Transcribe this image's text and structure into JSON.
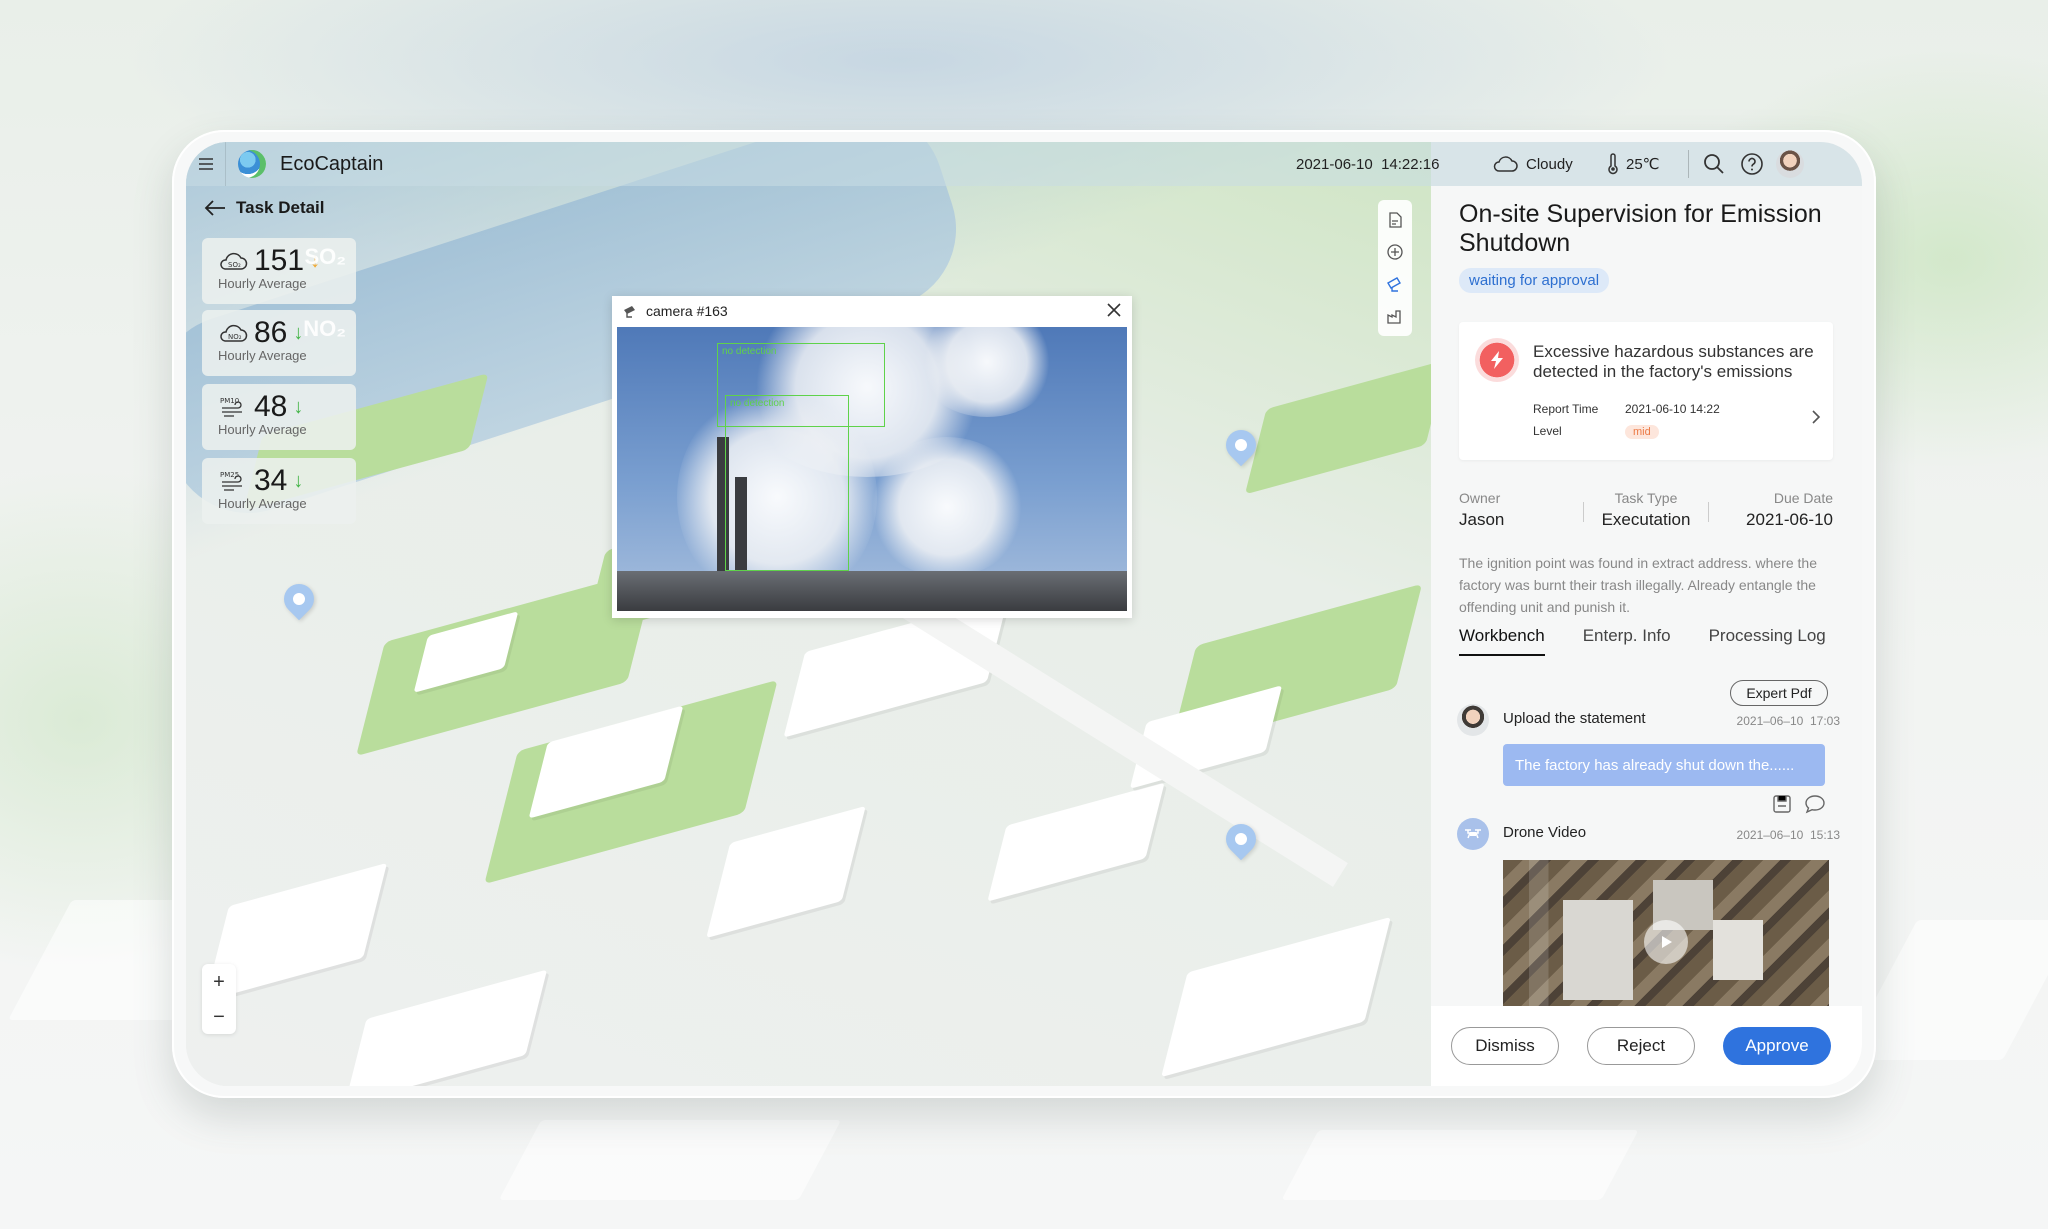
{
  "app": {
    "name": "EcoCaptain"
  },
  "topbar": {
    "date": "2021-06-10",
    "time": "14:22:16",
    "weather": "Cloudy",
    "temperature": "25℃"
  },
  "page": {
    "title": "Task Detail"
  },
  "metrics": [
    {
      "key": "SO₂",
      "value": "151",
      "trend": "up",
      "label": "Hourly Average",
      "arrow_color": "#f0a830"
    },
    {
      "key": "NO₂",
      "value": "86",
      "trend": "down",
      "label": "Hourly Average",
      "arrow_color": "#45b549"
    },
    {
      "key": "PM10",
      "value": "48",
      "trend": "down",
      "label": "Hourly Average",
      "arrow_color": "#45b549"
    },
    {
      "key": "PM25",
      "value": "34",
      "trend": "down",
      "label": "Hourly Average",
      "arrow_color": "#45b549"
    }
  ],
  "metric_arrows": {
    "up": "↓",
    "down": "↓"
  },
  "camera": {
    "title": "camera #163",
    "detections": [
      "no detection",
      "no detection"
    ]
  },
  "task": {
    "title": "On-site Supervision for Emission Shutdown",
    "status": "waiting for approval",
    "alert": {
      "message": "Excessive hazardous substances are detected in the factory's emissions",
      "report_time_label": "Report Time",
      "report_time": "2021-06-10 14:22",
      "level_label": "Level",
      "level": "mid"
    },
    "info": [
      {
        "label": "Owner",
        "value": "Jason"
      },
      {
        "label": "Task Type",
        "value": "Executation"
      },
      {
        "label": "Due Date",
        "value": "2021-06-10"
      }
    ],
    "description": "The ignition point was found in extract address. where the factory was burnt their trash illegally. Already entangle the offending unit and punish it."
  },
  "tabs": [
    {
      "label": "Workbench",
      "active": true
    },
    {
      "label": "Enterp. Info",
      "active": false
    },
    {
      "label": "Processing Log",
      "active": false
    }
  ],
  "export_label": "Expert Pdf",
  "log": [
    {
      "title": "Upload the statement",
      "date": "2021–06–10",
      "time": "17:03",
      "message": "The factory has already shut down the......"
    },
    {
      "title": "Drone Video",
      "date": "2021–06–10",
      "time": "15:13"
    }
  ],
  "actions": {
    "dismiss": "Dismiss",
    "reject": "Reject",
    "approve": "Approve"
  },
  "colors": {
    "accent": "#2f73de",
    "alert": "#f26060",
    "status_text": "#2d6fd0"
  }
}
